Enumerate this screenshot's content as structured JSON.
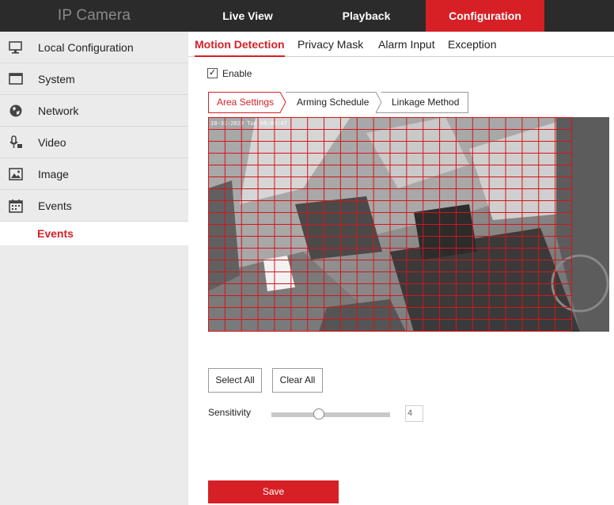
{
  "header": {
    "brand": "IP Camera",
    "nav": [
      {
        "label": "Live View"
      },
      {
        "label": "Playback"
      },
      {
        "label": "Configuration",
        "active": true
      }
    ]
  },
  "sidebar": {
    "items": [
      {
        "label": "Local Configuration",
        "icon": "monitor-icon"
      },
      {
        "label": "System",
        "icon": "window-icon"
      },
      {
        "label": "Network",
        "icon": "globe-icon"
      },
      {
        "label": "Video",
        "icon": "video-mic-icon"
      },
      {
        "label": "Image",
        "icon": "image-icon"
      },
      {
        "label": "Events",
        "icon": "calendar-icon"
      }
    ],
    "subitem": {
      "label": "Events",
      "active": true
    }
  },
  "tabs": [
    {
      "label": "Motion Detection",
      "active": true
    },
    {
      "label": "Privacy Mask"
    },
    {
      "label": "Alarm Input"
    },
    {
      "label": "Exception"
    }
  ],
  "enable": {
    "label": "Enable",
    "checked": true
  },
  "steps": [
    {
      "label": "Area Settings",
      "active": true
    },
    {
      "label": "Arming Schedule"
    },
    {
      "label": "Linkage Method"
    }
  ],
  "video": {
    "osd_text": "10-31-2023 Tue 09:08:47",
    "grid": {
      "columns": 22,
      "rows": 18
    },
    "grid_color": "#d7141a"
  },
  "buttons": {
    "select_all": "Select All",
    "clear_all": "Clear All",
    "save": "Save"
  },
  "sensitivity": {
    "label": "Sensitivity",
    "value": "4",
    "min": 0,
    "max": 10
  },
  "colors": {
    "accent": "#d71f26",
    "topbar": "#2b2b2b",
    "sidebar": "#ebebeb"
  }
}
